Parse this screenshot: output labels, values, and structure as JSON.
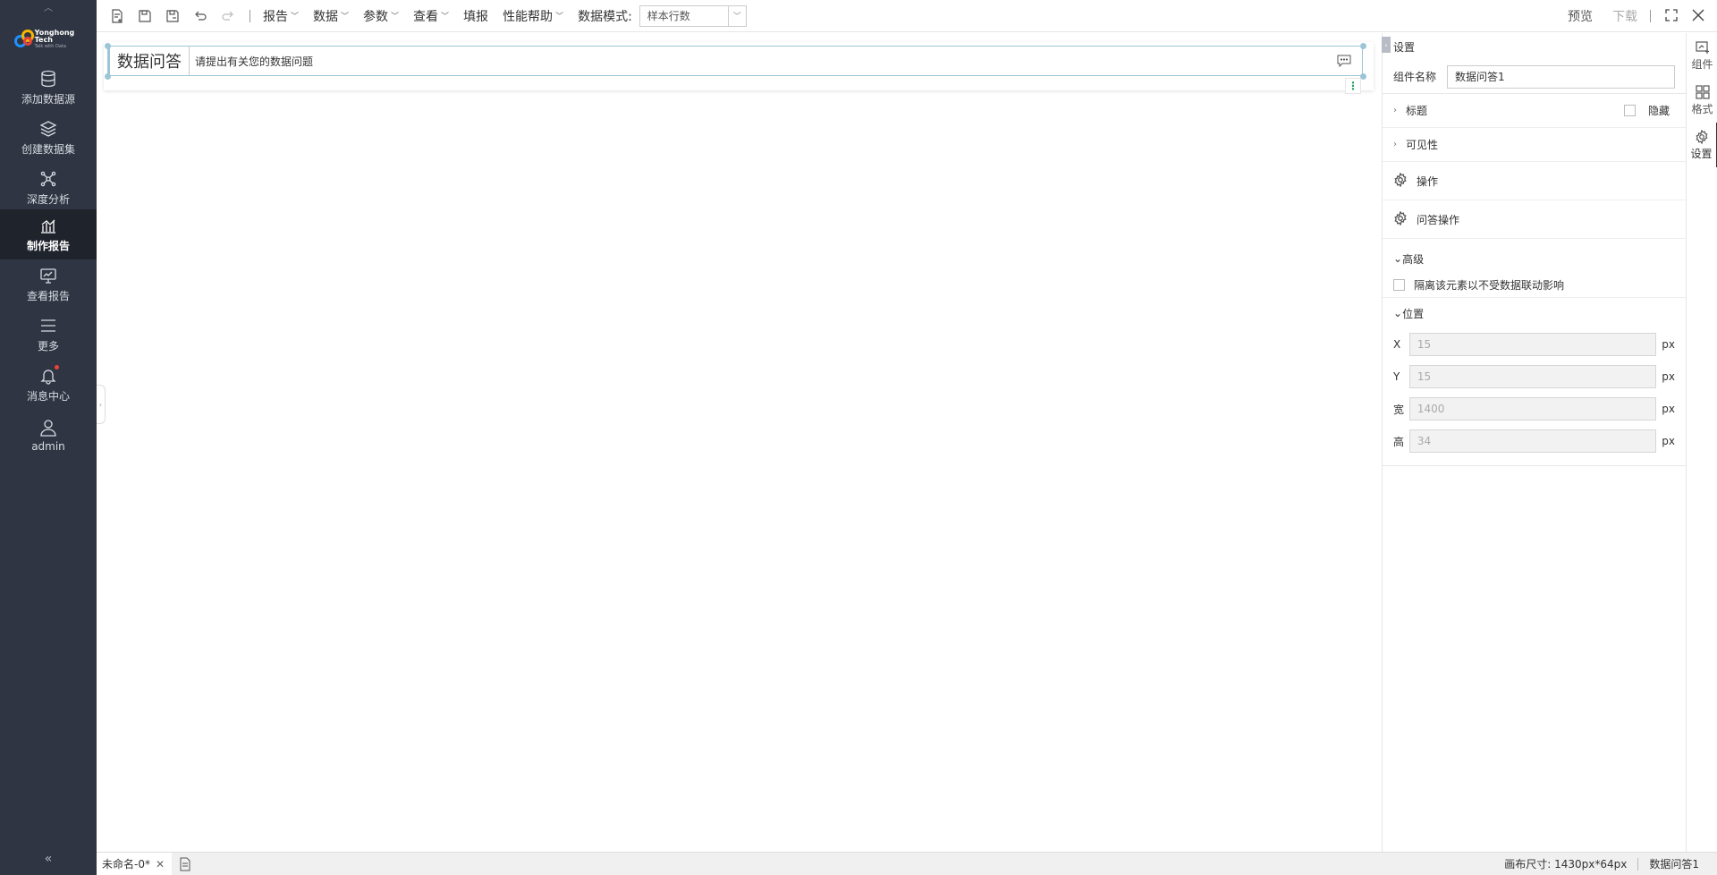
{
  "sidebar": {
    "logo": {
      "line1": "Yonghong Tech",
      "line2": "Talk with Data"
    },
    "items": [
      {
        "label": "添加数据源",
        "icon": "database-icon"
      },
      {
        "label": "创建数据集",
        "icon": "layers-icon"
      },
      {
        "label": "深度分析",
        "icon": "network-icon"
      },
      {
        "label": "制作报告",
        "icon": "chart-icon",
        "active": true
      },
      {
        "label": "查看报告",
        "icon": "monitor-chart-icon"
      },
      {
        "label": "更多",
        "icon": "menu-icon"
      },
      {
        "label": "消息中心",
        "icon": "bell-icon",
        "badge": true
      },
      {
        "label": "admin",
        "icon": "user-icon"
      }
    ],
    "collapse_glyph": "«"
  },
  "toolbar": {
    "menus": [
      {
        "label": "报告",
        "dropdown": true
      },
      {
        "label": "数据",
        "dropdown": true
      },
      {
        "label": "参数",
        "dropdown": true
      },
      {
        "label": "查看",
        "dropdown": true
      },
      {
        "label": "填报",
        "dropdown": false
      },
      {
        "label": "性能帮助",
        "dropdown": true
      }
    ],
    "data_mode_label": "数据模式:",
    "data_mode_value": "样本行数",
    "preview": "预览",
    "download": "下载"
  },
  "canvas": {
    "qa_title": "数据问答",
    "qa_placeholder": "请提出有关您的数据问题"
  },
  "panel": {
    "header": "设置",
    "component_name_label": "组件名称",
    "component_name_value": "数据问答1",
    "title_section": "标题",
    "hide_label": "隐藏",
    "visibility_section": "可见性",
    "operation": "操作",
    "qa_operation": "问答操作",
    "advanced": "高级",
    "isolate_label": "隔离该元素以不受数据联动影响",
    "position_section": "位置",
    "position": [
      {
        "label": "X",
        "value": "15",
        "unit": "px"
      },
      {
        "label": "Y",
        "value": "15",
        "unit": "px"
      },
      {
        "label": "宽",
        "value": "1400",
        "unit": "px"
      },
      {
        "label": "高",
        "value": "34",
        "unit": "px"
      }
    ]
  },
  "vtabs": [
    {
      "label": "组件",
      "icon": "component-icon"
    },
    {
      "label": "格式",
      "icon": "format-grid-icon"
    },
    {
      "label": "设置",
      "icon": "settings-gear-icon",
      "active": true
    }
  ],
  "statusbar": {
    "tab_name": "未命名-0*",
    "canvas_size": "画布尺寸: 1430px*64px",
    "selected_component": "数据问答1"
  }
}
